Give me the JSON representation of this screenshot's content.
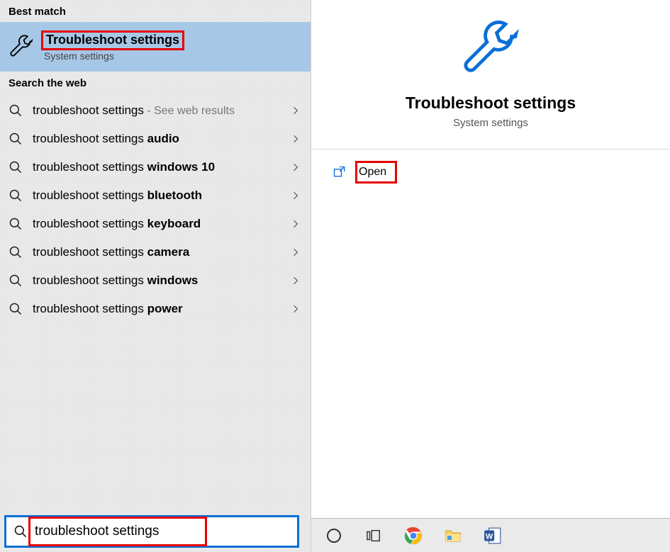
{
  "left": {
    "best_match_label": "Best match",
    "result": {
      "title": "Troubleshoot settings",
      "subtitle": "System settings"
    },
    "web_label": "Search the web",
    "items": [
      {
        "prefix": "troubleshoot settings",
        "bold": "",
        "suffix_grey": " - See web results"
      },
      {
        "prefix": "troubleshoot settings ",
        "bold": "audio",
        "suffix_grey": ""
      },
      {
        "prefix": "troubleshoot settings ",
        "bold": "windows 10",
        "suffix_grey": ""
      },
      {
        "prefix": "troubleshoot settings ",
        "bold": "bluetooth",
        "suffix_grey": ""
      },
      {
        "prefix": "troubleshoot settings ",
        "bold": "keyboard",
        "suffix_grey": ""
      },
      {
        "prefix": "troubleshoot settings ",
        "bold": "camera",
        "suffix_grey": ""
      },
      {
        "prefix": "troubleshoot settings ",
        "bold": "windows",
        "suffix_grey": ""
      },
      {
        "prefix": "troubleshoot settings ",
        "bold": "power",
        "suffix_grey": ""
      }
    ],
    "search_value": "troubleshoot settings"
  },
  "right": {
    "title": "Troubleshoot settings",
    "subtitle": "System settings",
    "open_label": "Open"
  },
  "taskbar": {
    "icons": [
      "cortana-circle",
      "task-view",
      "chrome",
      "file-explorer",
      "word"
    ]
  },
  "colors": {
    "accent": "#0a6fd6",
    "highlight_bg": "#a7c7e6",
    "annotation": "#e60000"
  }
}
